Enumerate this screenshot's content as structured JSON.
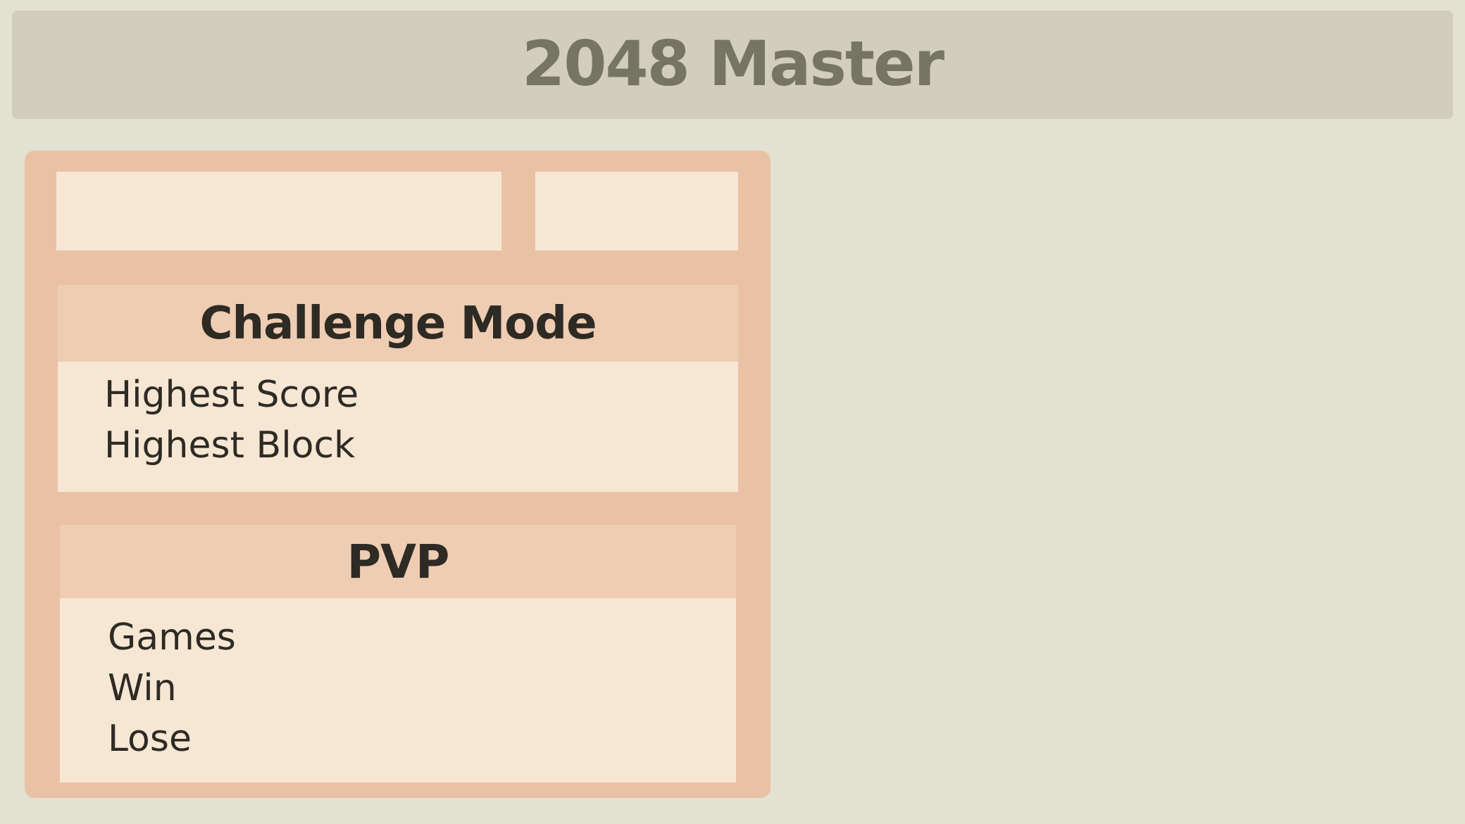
{
  "header": {
    "title": "2048 Master"
  },
  "challenge_mode": {
    "title": "Challenge Mode",
    "stats": [
      {
        "label": "Highest Score"
      },
      {
        "label": "Highest Block"
      }
    ]
  },
  "pvp": {
    "title": "PVP",
    "stats": [
      {
        "label": "Games"
      },
      {
        "label": "Win"
      },
      {
        "label": "Lose"
      }
    ]
  },
  "colors": {
    "background": "#e3e1d2",
    "header_bg": "#d1cec0",
    "header_text": "#767462",
    "panel_bg": "#e9c2a5",
    "section_head_bg": "#eecdb2",
    "cell_bg": "#f6e7d4",
    "text": "#2e2a24"
  }
}
